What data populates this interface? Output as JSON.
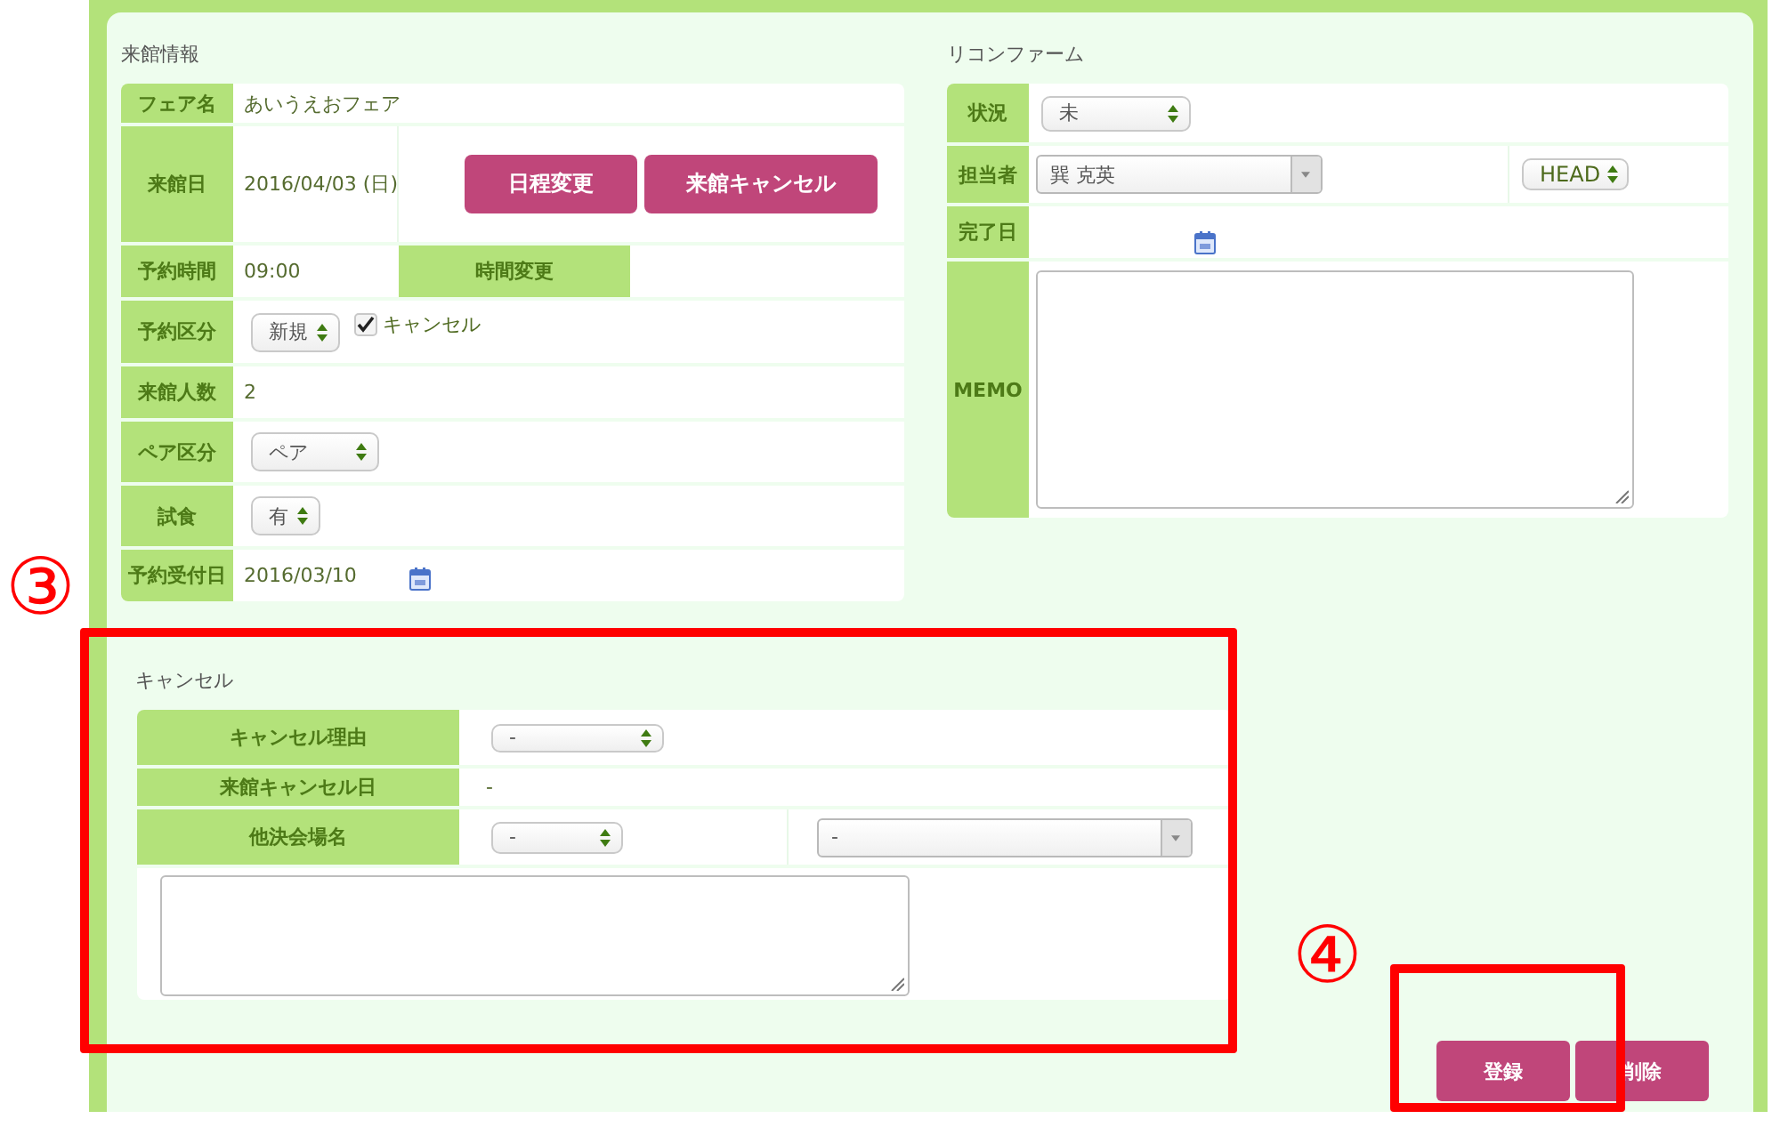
{
  "visit_info": {
    "title": "来館情報",
    "rows": [
      {
        "kind": "text",
        "label": "フェア名",
        "value": "あいうえおフェア"
      },
      {
        "kind": "date_actions",
        "label": "来館日",
        "value": "2016/04/03 (日)",
        "buttons": [
          "日程変更",
          "来館キャンセル"
        ]
      },
      {
        "kind": "time",
        "label": "予約時間",
        "value": "09:00",
        "action": "時間変更"
      },
      {
        "kind": "select_check",
        "label": "予約区分",
        "select": "新規",
        "checkbox": {
          "label": "キャンセル",
          "checked": true
        }
      },
      {
        "kind": "text",
        "label": "来館人数",
        "value": "2"
      },
      {
        "kind": "select",
        "label": "ペア区分",
        "select": "ペア"
      },
      {
        "kind": "select",
        "label": "試食",
        "select": "有"
      },
      {
        "kind": "date",
        "label": "予約受付日",
        "value": "2016/03/10"
      }
    ]
  },
  "reconfirm": {
    "title": "リコンファーム",
    "rows": [
      {
        "kind": "select",
        "label": "状況",
        "select": "未"
      },
      {
        "kind": "staff",
        "label": "担当者",
        "combo": "巽 克英",
        "select": "HEAD"
      },
      {
        "kind": "date",
        "label": "完了日"
      },
      {
        "kind": "memo",
        "label": "MEMO"
      }
    ]
  },
  "cancel": {
    "title": "キャンセル",
    "rows": [
      {
        "kind": "select",
        "label": "キャンセル理由",
        "select": "-"
      },
      {
        "kind": "text",
        "label": "来館キャンセル日",
        "value": "-"
      },
      {
        "kind": "venue",
        "label": "他決会場名",
        "select": "-",
        "combo": "-"
      },
      {
        "kind": "memo"
      }
    ]
  },
  "buttons": [
    "登録",
    "削除"
  ],
  "annotations": [
    {
      "label": "③"
    },
    {
      "label": "④"
    }
  ]
}
